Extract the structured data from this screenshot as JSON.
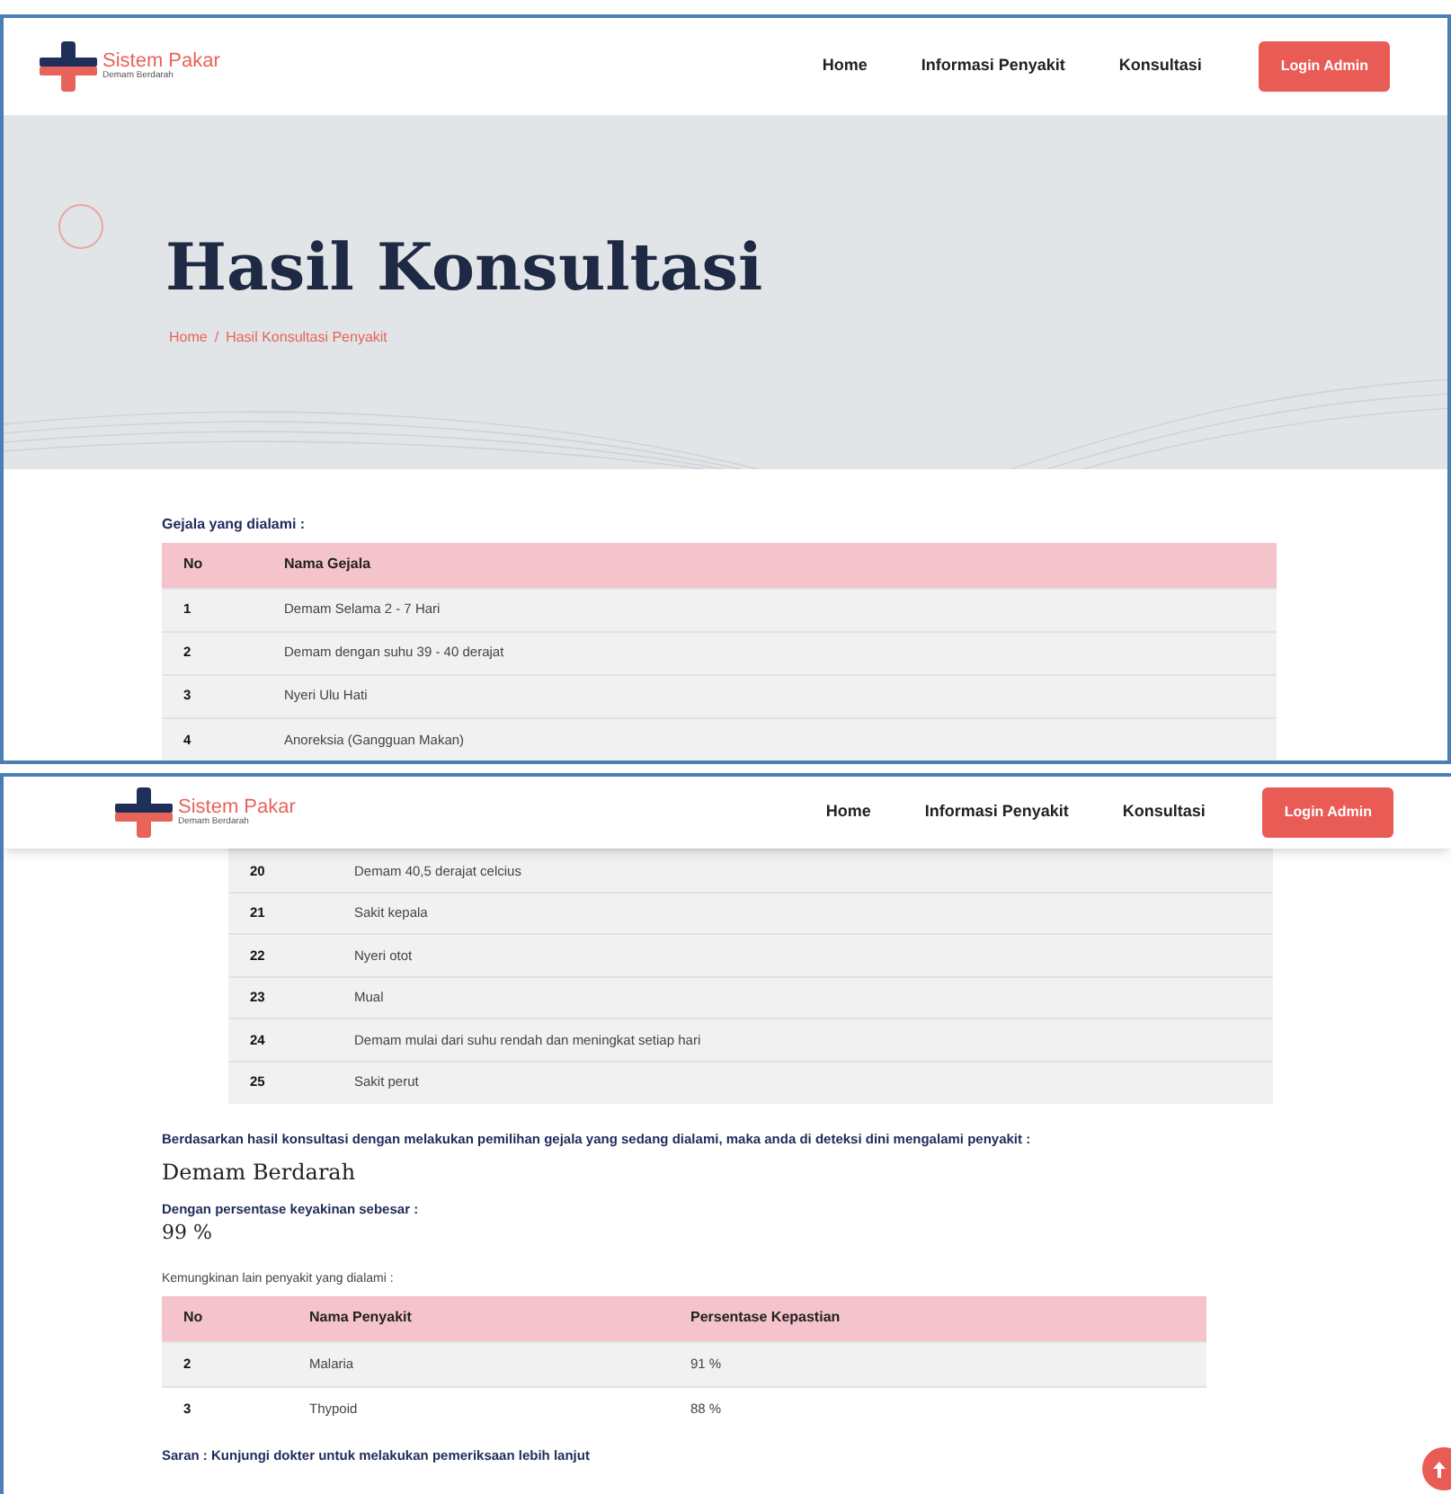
{
  "top_view": {
    "navbar": {
      "brand": "Sistem Pakar",
      "tagline": "Demam Berdarah",
      "links": [
        {
          "label": "Home"
        },
        {
          "label": "Informasi Penyakit"
        },
        {
          "label": "Konsultasi"
        }
      ],
      "login_button": "Login Admin"
    },
    "hero": {
      "title": "Hasil Konsultasi",
      "breadcrumb": [
        "Home",
        "/",
        "Hasil Konsultasi Penyakit"
      ]
    },
    "symptoms_label": "Gejala yang dialami :",
    "symptoms_table": {
      "columns": [
        "No",
        "Nama Gejala"
      ],
      "rows": [
        [
          "1",
          "Demam Selama 2 - 7 Hari"
        ],
        [
          "2",
          "Demam dengan suhu 39 - 40 derajat"
        ],
        [
          "3",
          "Nyeri Ulu Hati"
        ],
        [
          "4",
          "Anoreksia (Gangguan Makan)"
        ]
      ]
    }
  },
  "bottom_view": {
    "navbar": {
      "brand": "Sistem Pakar",
      "tagline": "Demam Berdarah",
      "links": [
        {
          "label": "Home"
        },
        {
          "label": "Informasi Penyakit"
        },
        {
          "label": "Konsultasi"
        }
      ],
      "login_button": "Login Admin"
    },
    "symptoms_rows": [
      [
        "20",
        "Demam 40,5 derajat celcius"
      ],
      [
        "21",
        "Sakit kepala"
      ],
      [
        "22",
        "Nyeri otot"
      ],
      [
        "23",
        "Mual"
      ],
      [
        "24",
        "Demam mulai dari suhu rendah dan meningkat setiap hari"
      ],
      [
        "25",
        "Sakit perut"
      ]
    ],
    "result_label": "Berdasarkan hasil konsultasi dengan melakukan pemilihan gejala yang sedang dialami, maka anda di deteksi dini mengalami penyakit :",
    "result_disease": "Demam Berdarah",
    "confidence_label": "Dengan persentase keyakinan sebesar :",
    "confidence_value": "99 %",
    "other_label": "Kemungkinan lain penyakit yang dialami :",
    "other_table": {
      "columns": [
        "No",
        "Nama Penyakit",
        "Persentase Kepastian"
      ],
      "rows": [
        [
          "2",
          "Malaria",
          "91 %"
        ],
        [
          "3",
          "Thypoid",
          "88 %"
        ]
      ]
    },
    "advice": "Saran : Kunjungi dokter untuk melakukan pemeriksaan lebih lanjut"
  }
}
